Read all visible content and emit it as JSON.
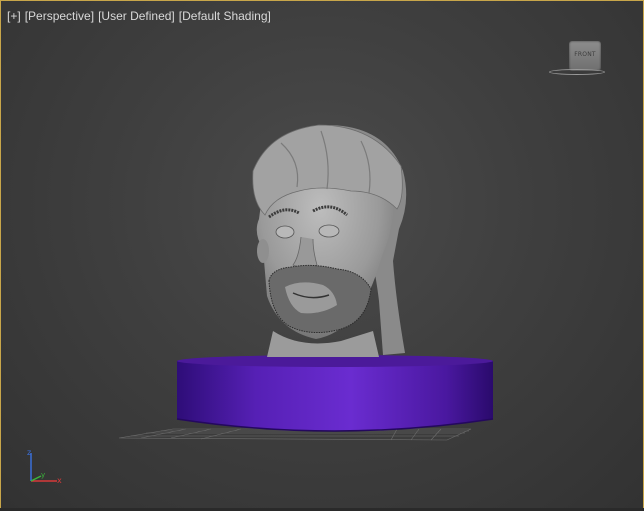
{
  "viewport": {
    "labels": [
      {
        "id": "plus",
        "text": "[+]"
      },
      {
        "id": "view",
        "text": "[Perspective]"
      },
      {
        "id": "camera",
        "text": "[User Defined]"
      },
      {
        "id": "shading",
        "text": "[Default Shading]"
      }
    ],
    "viewcube_label": "FRONT",
    "axis_labels": {
      "z": "z",
      "y": "y",
      "x": "x"
    }
  },
  "colors": {
    "background": "#3f3f3f",
    "viewport_border": "#c8a64a",
    "pedestal": "#5a1fb5",
    "sculpt": "#a7a7a7",
    "axis_x": "#d83a3a",
    "axis_y": "#3ab53a",
    "axis_z": "#3a6fd8"
  },
  "icons": {
    "viewcube": "viewcube-icon",
    "axis": "axis-tripod-icon"
  }
}
